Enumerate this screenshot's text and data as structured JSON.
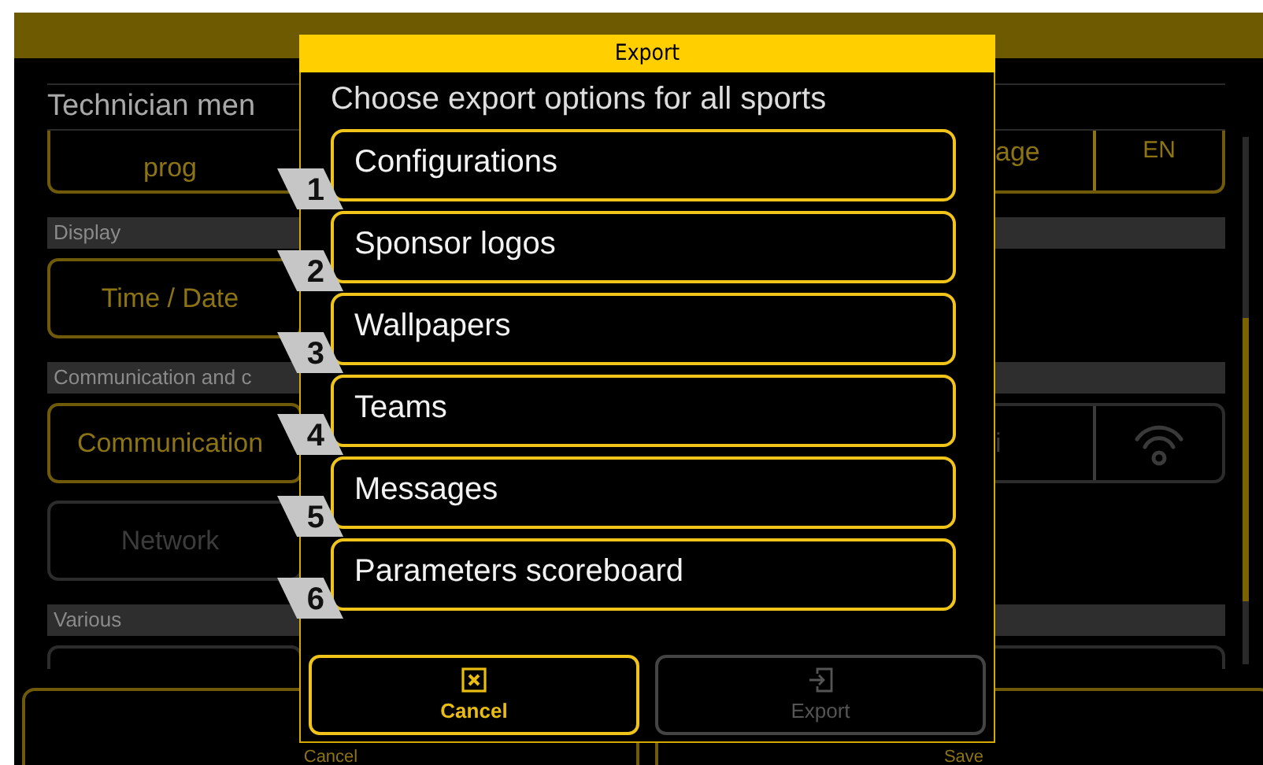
{
  "background": {
    "title": "Technician men",
    "rows": [
      {
        "kind": "scrolled",
        "label": "prog",
        "disabled": false,
        "right": {
          "kind": "value",
          "label": "age",
          "value": "EN",
          "disabled": false
        }
      },
      {
        "kind": "header",
        "label": "Display"
      },
      {
        "kind": "button",
        "label": "Time / Date",
        "disabled": false
      },
      {
        "kind": "header",
        "label": "Communication and c"
      },
      {
        "kind": "button",
        "label": "Communication",
        "disabled": false,
        "right": {
          "kind": "icon-toggle",
          "label": "i",
          "disabled": true
        }
      },
      {
        "kind": "button",
        "label": "Network",
        "disabled": true
      },
      {
        "kind": "header",
        "label": "Various"
      },
      {
        "kind": "stub",
        "disabled": true
      }
    ],
    "footer": [
      {
        "label": "Cancel"
      },
      {
        "label": "Save"
      }
    ]
  },
  "dialog": {
    "title": "Export",
    "prompt": "Choose export options for all sports",
    "options": [
      {
        "number": "1",
        "label": "Configurations"
      },
      {
        "number": "2",
        "label": "Sponsor logos"
      },
      {
        "number": "3",
        "label": "Wallpapers"
      },
      {
        "number": "4",
        "label": "Teams"
      },
      {
        "number": "5",
        "label": "Messages"
      },
      {
        "number": "6",
        "label": "Parameters scoreboard"
      }
    ],
    "buttons": [
      {
        "kind": "cancel",
        "label": "Cancel",
        "disabled": false
      },
      {
        "kind": "export",
        "label": "Export",
        "disabled": true
      }
    ]
  }
}
